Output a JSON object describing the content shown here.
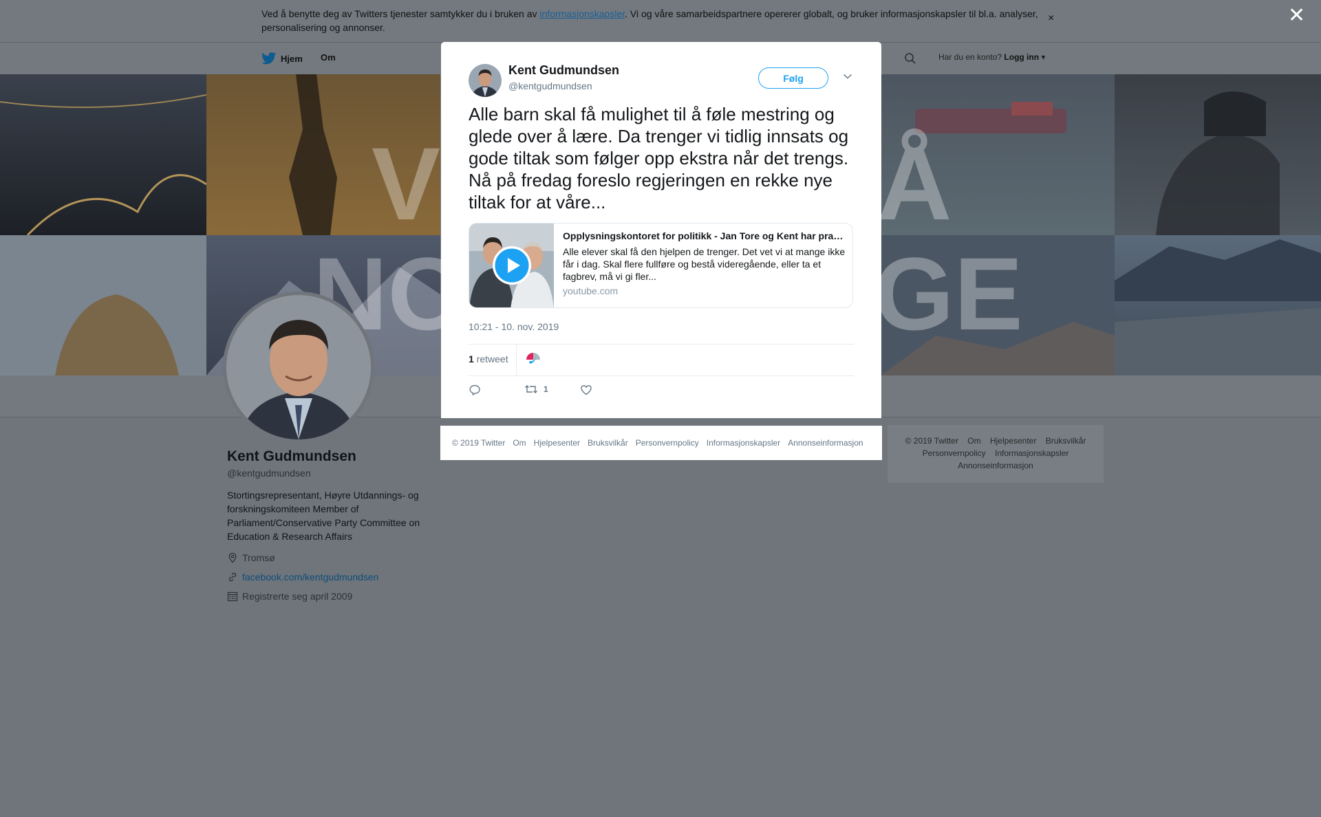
{
  "cookie_banner": {
    "text_before": "Ved å benytte deg av Twitters tjenester samtykker du i bruken av ",
    "link_text": "informasjonskapsler",
    "text_after": ". Vi og våre samarbeidspartnere opererer globalt, og bruker informasjonskapsler til bl.a. analyser, personalisering og annonser.",
    "close_glyph": "×"
  },
  "overlay_close_glyph": "✕",
  "nav": {
    "home_label": "Hjem",
    "about_label": "Om",
    "login_prompt": "Har du en konto?",
    "login_label": "Logg inn"
  },
  "header_letters": [
    "V",
    "Å",
    "NO",
    "GE"
  ],
  "profile": {
    "name": "Kent Gudmundsen",
    "handle": "@kentgudmundsen",
    "bio": "Stortingsrepresentant, Høyre Utdannings- og forskningskomiteen Member of Parliament/Conservative Party Committee on Education & Research Affairs",
    "location": "Tromsø",
    "website": "facebook.com/kentgudmundsen",
    "joined": "Registrerte seg april 2009"
  },
  "tweet": {
    "author_name": "Kent Gudmundsen",
    "author_handle": "@kentgudmundsen",
    "follow_label": "Følg",
    "text": "Alle barn skal få mulighet til å føle mestring og glede over å lære. Da trenger vi tidlig innsats og gode tiltak som følger opp ekstra når det trengs. Nå på fredag foreslo regjeringen en rekke nye tiltak for at våre...",
    "card": {
      "title": "Opplysningskontoret for politikk - Jan Tore og Kent har praktisk ...",
      "description": "Alle elever skal få den hjelpen de trenger. Det vet vi at mange ikke får i dag. Skal flere fullføre og bestå videregående, eller ta et fagbrev, må vi gi fler...",
      "domain": "youtube.com"
    },
    "timestamp": "10:21 - 10. nov. 2019",
    "retweet_count": "1",
    "retweet_label": "retweet",
    "action_retweet_count": "1"
  },
  "modal_footer_links": [
    "© 2019 Twitter",
    "Om",
    "Hjelpesenter",
    "Bruksvilkår",
    "Personvernpolicy",
    "Informasjonskapsler",
    "Annonseinformasjon"
  ],
  "right_footer": {
    "line1": [
      "© 2019 Twitter",
      "Om",
      "Hjelpesenter",
      "Bruksvilkår"
    ],
    "line2": [
      "Personvernpolicy",
      "Informasjonskapsler"
    ],
    "line3": [
      "Annonseinformasjon"
    ]
  },
  "colors": {
    "twitter_blue": "#1da1f2",
    "link_blue": "#1b5f95",
    "overlay_gray": "#6f757a"
  },
  "icons": [
    "twitter-bird-icon",
    "search-icon",
    "close-icon",
    "chevron-down-icon",
    "location-icon",
    "link-icon",
    "calendar-icon",
    "reply-icon",
    "retweet-icon",
    "heart-icon",
    "play-icon"
  ]
}
